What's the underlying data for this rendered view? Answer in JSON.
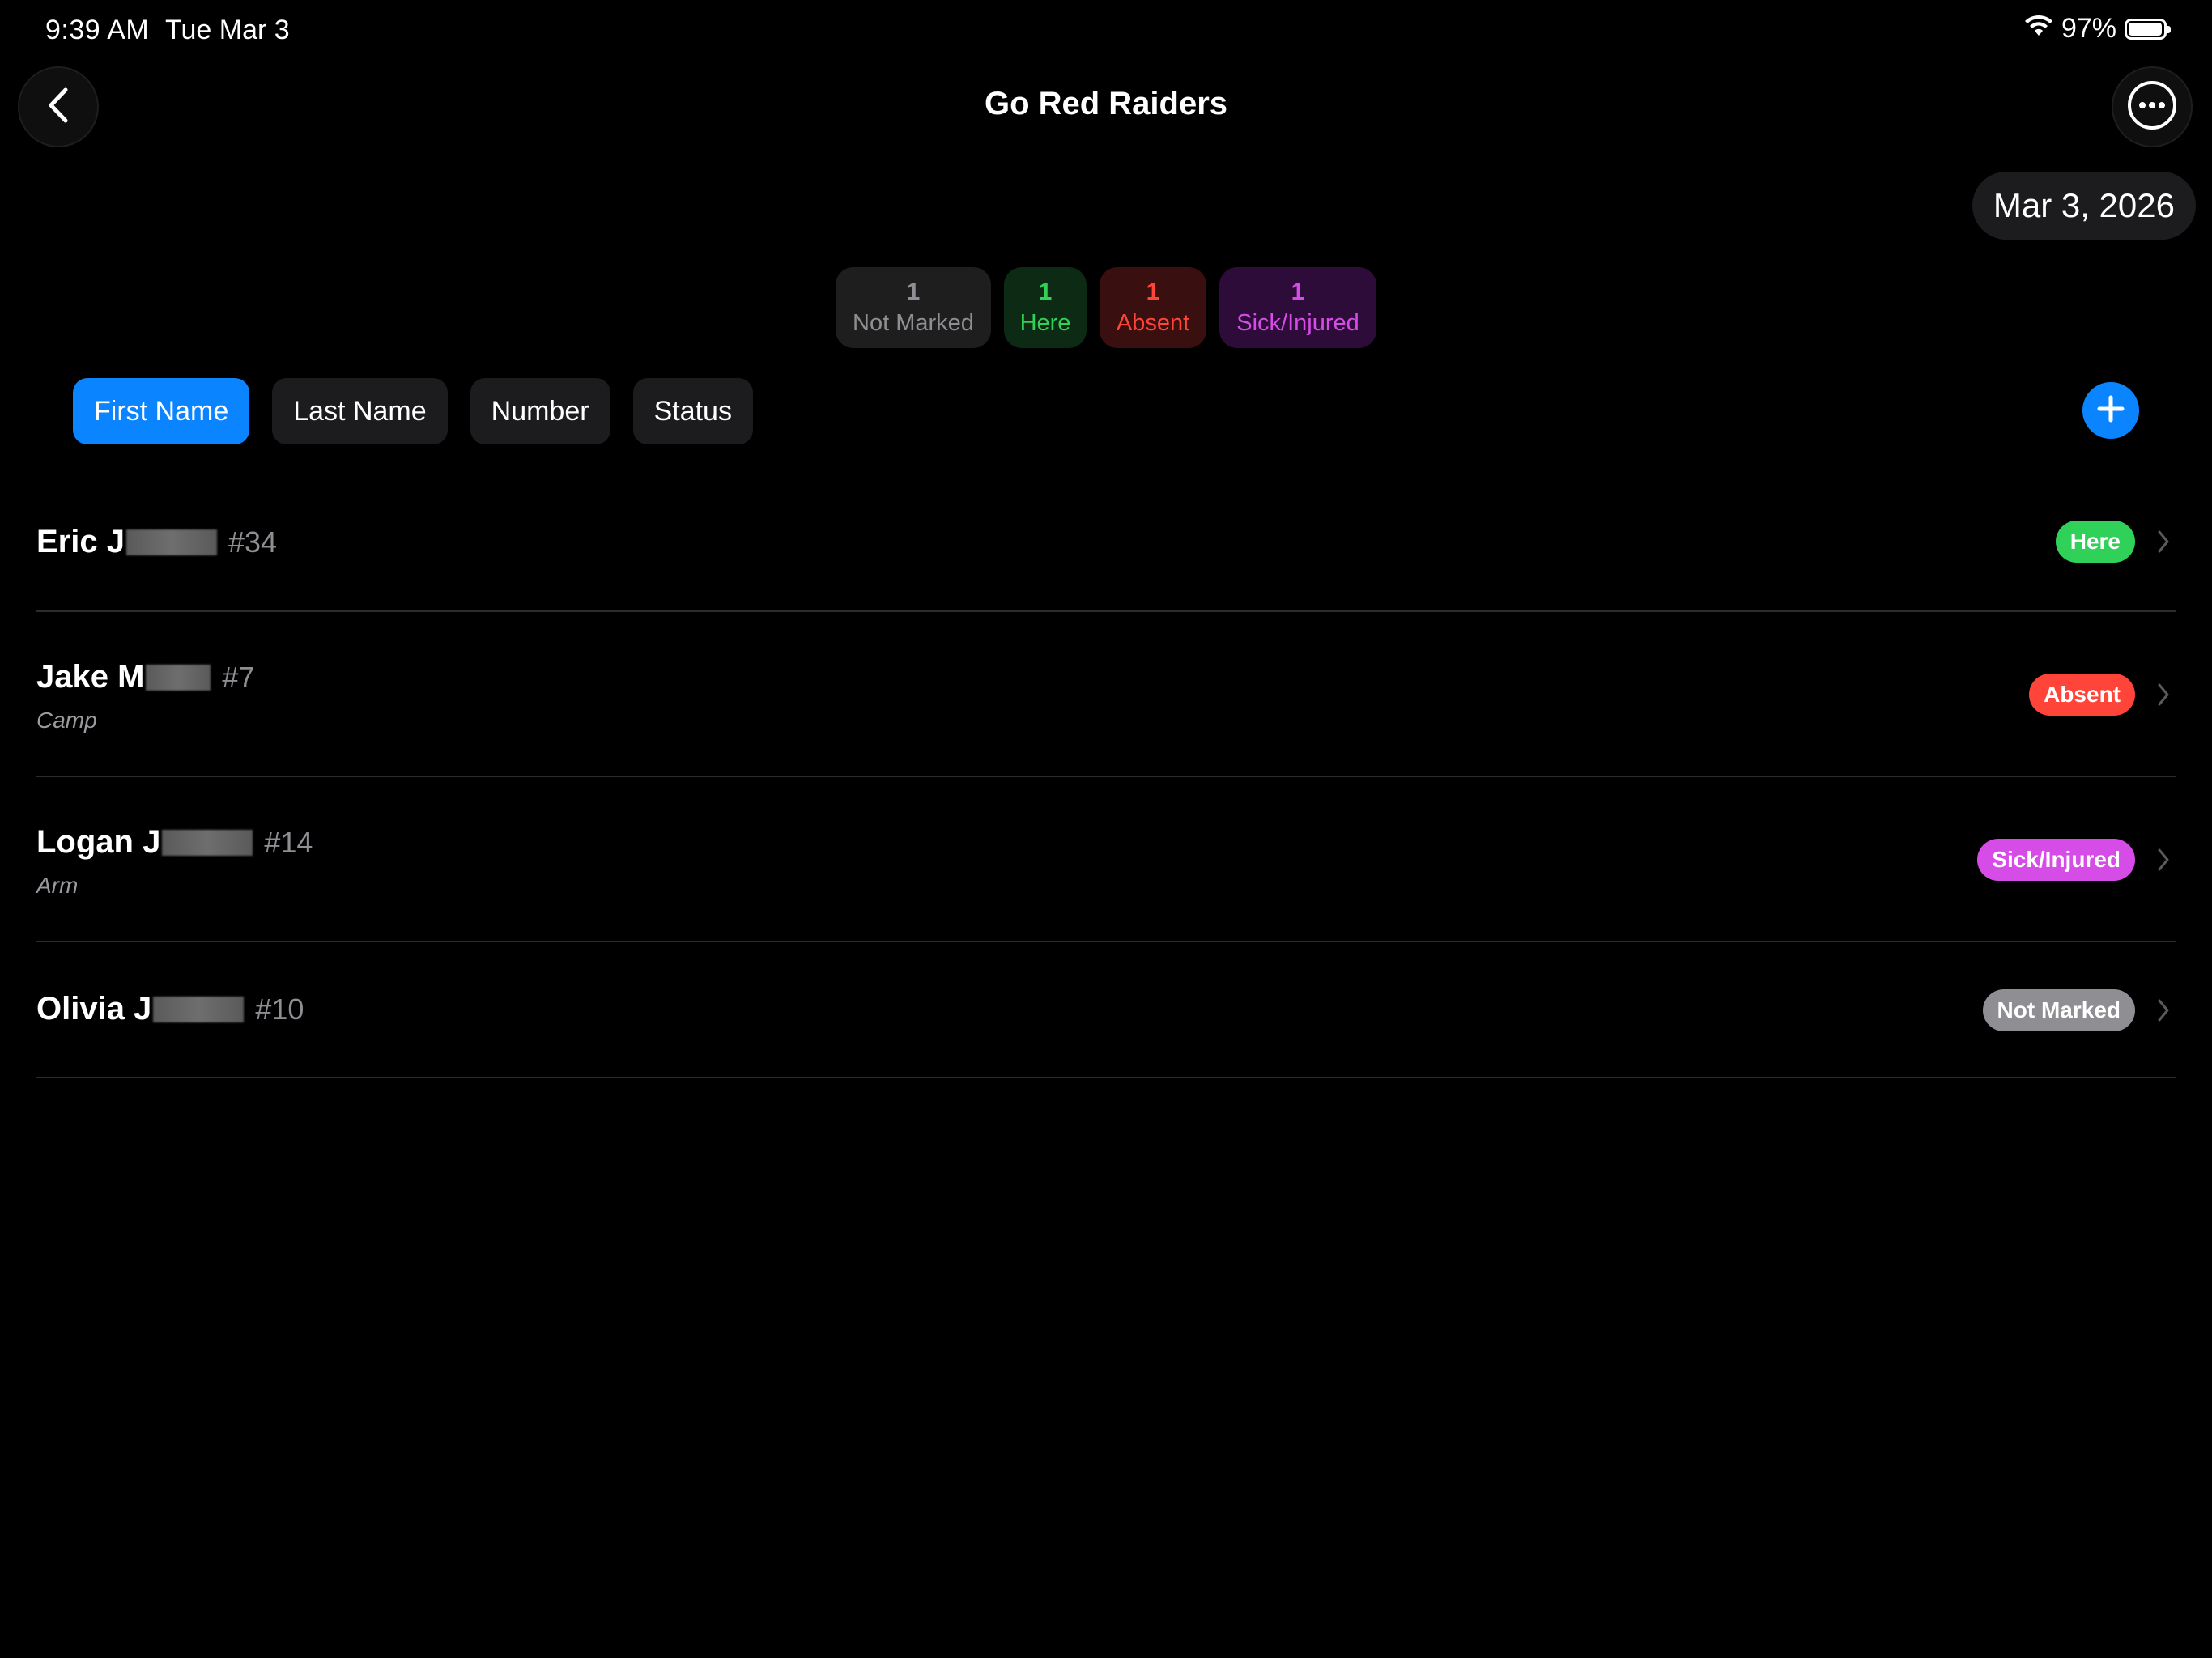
{
  "status_bar": {
    "time": "9:39 AM",
    "date": "Tue Mar 3",
    "battery": "97%",
    "battery_level": 0.97
  },
  "nav": {
    "title": "Go Red Raiders",
    "back_icon": "chevron-left-icon",
    "more_icon": "ellipsis-circle-icon"
  },
  "date_picker": {
    "value": "Mar 3, 2026"
  },
  "summary": [
    {
      "count": "1",
      "label": "Not Marked",
      "color": "#8e8e93"
    },
    {
      "count": "1",
      "label": "Here",
      "color": "#30d158"
    },
    {
      "count": "1",
      "label": "Absent",
      "color": "#ff453a"
    },
    {
      "count": "1",
      "label": "Sick/Injured",
      "color": "#d64ce6"
    }
  ],
  "sort_tabs": [
    {
      "label": "First Name",
      "active": true
    },
    {
      "label": "Last Name",
      "active": false
    },
    {
      "label": "Number",
      "active": false
    },
    {
      "label": "Status",
      "active": false
    }
  ],
  "add_button_icon": "plus-icon",
  "accent_color": "#0a84ff",
  "players": [
    {
      "name": "Eric J",
      "number": "#34",
      "note": "",
      "status": "Here",
      "status_color": "#30d158"
    },
    {
      "name": "Jake M",
      "number": "#7",
      "note": "Camp",
      "status": "Absent",
      "status_color": "#ff453a"
    },
    {
      "name": "Logan J",
      "number": "#14",
      "note": "Arm",
      "status": "Sick/Injured",
      "status_color": "#d64ce6"
    },
    {
      "name": "Olivia J",
      "number": "#10",
      "note": "",
      "status": "Not Marked",
      "status_color": "#8e8e93"
    }
  ]
}
